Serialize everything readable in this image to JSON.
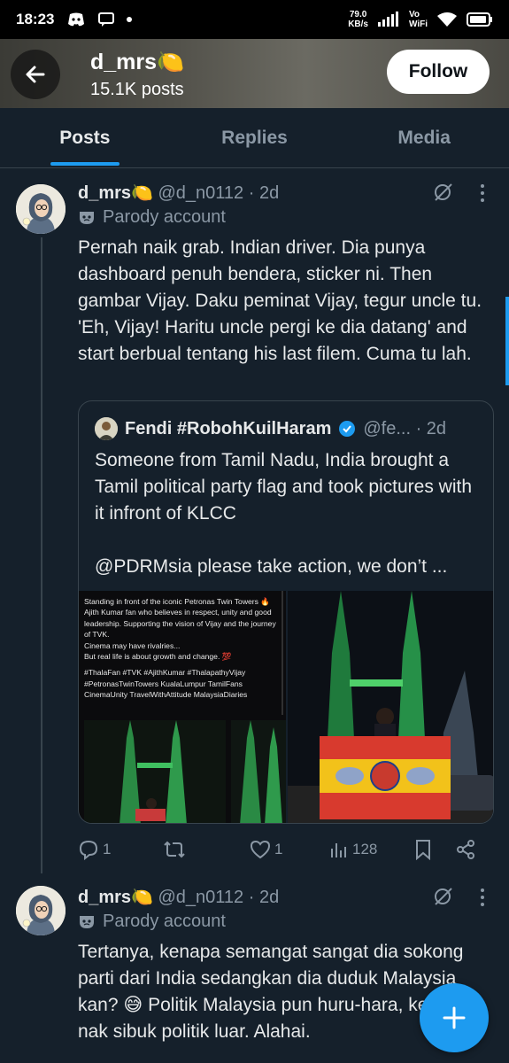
{
  "status_bar": {
    "time": "18:23",
    "net_speed": "79.0",
    "net_unit": "KB/s",
    "vowifi_top": "Vo",
    "vowifi_bottom": "WiFi"
  },
  "header": {
    "name": "d_mrs🍋",
    "subtitle": "15.1K posts",
    "follow_label": "Follow"
  },
  "tabs": [
    {
      "label": "Posts",
      "active": true
    },
    {
      "label": "Replies",
      "active": false
    },
    {
      "label": "Media",
      "active": false
    }
  ],
  "tweets": [
    {
      "name": "d_mrs🍋",
      "meta": " @d_n0112 · 2d",
      "label": "Parody account",
      "text": "Pernah naik grab. Indian driver. Dia punya dashboard penuh bendera, sticker ni. Then gambar Vijay. Daku peminat Vijay, tegur uncle tu. 'Eh, Vijay! Haritu uncle pergi ke dia datang' and start berbual tentang his last filem. Cuma tu lah.",
      "quote": {
        "name": "Fendi #RobohKuilHaram",
        "meta": "@fe... · 2d",
        "text_line1": "Someone from Tamil Nadu, India brought a Tamil political party flag and took pictures with it infront of KLCC",
        "text_line2": "@PDRMsia please take action, we don’t ...",
        "media_caption": [
          "Standing in front of the iconic Petronas Twin Towers 🔥",
          "Ajith Kumar fan who believes in respect, unity and good leadership. Supporting the vision of Vijay and the journey of TVK.",
          "Cinema may have rivalries...",
          "But real life is about growth and change. 💯",
          "",
          "#ThalaFan #TVK #AjithKumar #ThalapathyVijay #PetronasTwinTowers KualaLumpur TamilFans CinemaUnity TravelWithAttitude MalaysiaDiaries"
        ]
      },
      "actions": {
        "replies": "1",
        "reposts": "",
        "likes": "1",
        "views": "128"
      }
    },
    {
      "name": "d_mrs🍋",
      "meta": " @d_n0112 · 2d",
      "label": "Parody account",
      "text": "Tertanya, kenapa semangat sangat dia sokong parti dari India sedangkan dia duduk Malaysia kan? 😅 Politik Malaysia pun huru-hara, kenapa nak sibuk politik luar. Alahai."
    }
  ],
  "colors": {
    "background": "#15202b",
    "accent": "#1d9bf0",
    "muted": "#8b98a5",
    "text": "#e7e9ea"
  }
}
